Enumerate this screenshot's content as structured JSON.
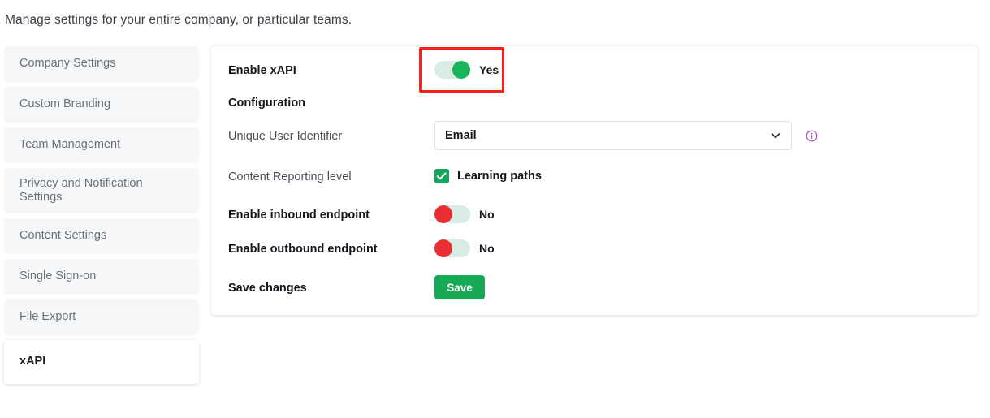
{
  "header": {
    "subtitle": "Manage settings for your entire company, or particular teams."
  },
  "sidebar": {
    "items": [
      {
        "label": "Company Settings",
        "selected": false
      },
      {
        "label": "Custom Branding",
        "selected": false
      },
      {
        "label": "Team Management",
        "selected": false
      },
      {
        "label": "Privacy and Notification Settings",
        "selected": false
      },
      {
        "label": "Content Settings",
        "selected": false
      },
      {
        "label": "Single Sign-on",
        "selected": false
      },
      {
        "label": "File Export",
        "selected": false
      },
      {
        "label": "xAPI",
        "selected": true
      }
    ]
  },
  "main": {
    "enable_xapi": {
      "label": "Enable xAPI",
      "toggle_state": "on",
      "toggle_text": "Yes"
    },
    "configuration_heading": "Configuration",
    "unique_user_identifier": {
      "label": "Unique User Identifier",
      "value": "Email",
      "options": [
        "Email"
      ],
      "chevron_icon": "chevron-down-icon",
      "info_icon": "info-icon"
    },
    "content_reporting_level": {
      "label": "Content Reporting level",
      "checkbox_label": "Learning paths",
      "checked": true
    },
    "enable_inbound_endpoint": {
      "label": "Enable inbound endpoint",
      "toggle_state": "off",
      "toggle_text": "No"
    },
    "enable_outbound_endpoint": {
      "label": "Enable outbound endpoint",
      "toggle_state": "off",
      "toggle_text": "No"
    },
    "save_changes": {
      "label": "Save changes",
      "button_label": "Save"
    }
  },
  "colors": {
    "toggle_on": "#17b45c",
    "toggle_off": "#ea2f34",
    "toggle_track": "#d9ece3",
    "checkbox_green": "#14a75b",
    "save_green": "#18a957",
    "highlight_red": "#f42318",
    "info_purple": "#a23fc4",
    "sidebar_item_bg": "#f6f7f9"
  }
}
